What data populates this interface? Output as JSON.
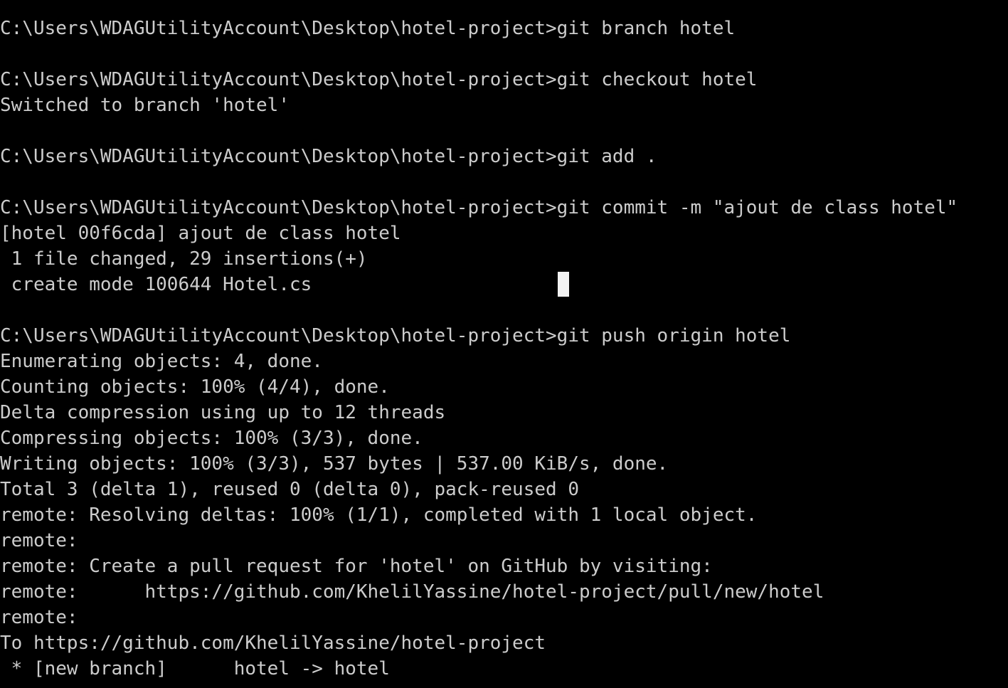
{
  "terminal": {
    "lines": [
      "C:\\Users\\WDAGUtilityAccount\\Desktop\\hotel-project>git branch hotel",
      "",
      "C:\\Users\\WDAGUtilityAccount\\Desktop\\hotel-project>git checkout hotel",
      "Switched to branch 'hotel'",
      "",
      "C:\\Users\\WDAGUtilityAccount\\Desktop\\hotel-project>git add .",
      "",
      "C:\\Users\\WDAGUtilityAccount\\Desktop\\hotel-project>git commit -m \"ajout de class hotel\"",
      "[hotel 00f6cda] ajout de class hotel",
      " 1 file changed, 29 insertions(+)",
      " create mode 100644 Hotel.cs",
      "",
      "C:\\Users\\WDAGUtilityAccount\\Desktop\\hotel-project>git push origin hotel",
      "Enumerating objects: 4, done.",
      "Counting objects: 100% (4/4), done.",
      "Delta compression using up to 12 threads",
      "Compressing objects: 100% (3/3), done.",
      "Writing objects: 100% (3/3), 537 bytes | 537.00 KiB/s, done.",
      "Total 3 (delta 1), reused 0 (delta 0), pack-reused 0",
      "remote: Resolving deltas: 100% (1/1), completed with 1 local object.",
      "remote:",
      "remote: Create a pull request for 'hotel' on GitHub by visiting:",
      "remote:      https://github.com/KhelilYassine/hotel-project/pull/new/hotel",
      "remote:",
      "To https://github.com/KhelilYassine/hotel-project",
      " * [new branch]      hotel -> hotel"
    ]
  },
  "colors": {
    "background": "#000000",
    "text": "#cccccc",
    "cursor": "#f2f2f2"
  }
}
